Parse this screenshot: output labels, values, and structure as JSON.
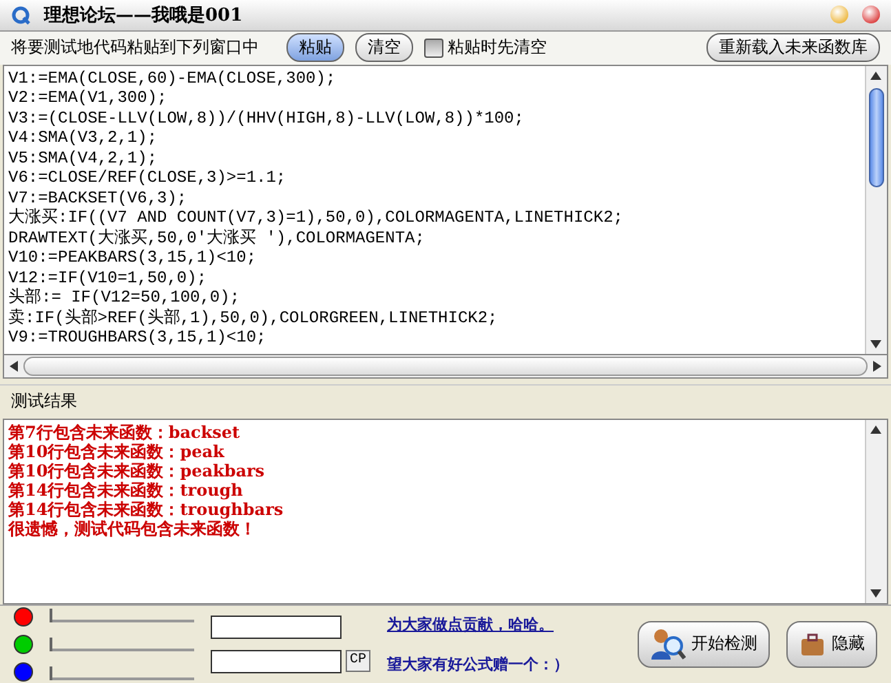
{
  "window": {
    "title": "理想论坛——我哦是001"
  },
  "toolbar": {
    "hint": "将要测试地代码粘贴到下列窗口中",
    "buttons": [
      {
        "label": "粘贴",
        "selected": true
      },
      {
        "label": "清空",
        "selected": false
      }
    ],
    "clear_before_paste": {
      "label": "粘贴时先清空",
      "checked": false
    },
    "reload_button": "重新载入未来函数库"
  },
  "code_lines": [
    "V1:=EMA(CLOSE,60)-EMA(CLOSE,300);",
    "V2:=EMA(V1,300);",
    "V3:=(CLOSE-LLV(LOW,8))/(HHV(HIGH,8)-LLV(LOW,8))*100;",
    "V4:SMA(V3,2,1);",
    "V5:SMA(V4,2,1);",
    "V6:=CLOSE/REF(CLOSE,3)>=1.1;",
    "V7:=BACKSET(V6,3);",
    "大涨买:IF((V7 AND COUNT(V7,3)=1),50,0),COLORMAGENTA,LINETHICK2;",
    "DRAWTEXT(大涨买,50,0'大涨买 '),COLORMAGENTA;",
    "V10:=PEAKBARS(3,15,1)<10;",
    "V12:=IF(V10=1,50,0);",
    "头部:= IF(V12=50,100,0);",
    "卖:IF(头部>REF(头部,1),50,0),COLORGREEN,LINETHICK2;",
    "V9:=TROUGHBARS(3,15,1)<10;"
  ],
  "results_label": "测试结果",
  "results": [
    "第7行包含未来函数：backset",
    "第10行包含未来函数：peak",
    "第10行包含未来函数：peakbars",
    "第14行包含未来函数：trough",
    "第14行包含未来函数：troughbars",
    "很遗憾，测试代码包含未来函数！"
  ],
  "sliders": [
    {
      "color": "#ff0000",
      "level": 0
    },
    {
      "color": "#00cc00",
      "level": 0
    },
    {
      "color": "#0000ff",
      "level": 0
    }
  ],
  "cp_button": "CP",
  "links": [
    "为大家做点贡献，哈哈。",
    "望大家有好公式赠一个：）"
  ],
  "start_button": "开始检测",
  "second_button": "隐藏"
}
